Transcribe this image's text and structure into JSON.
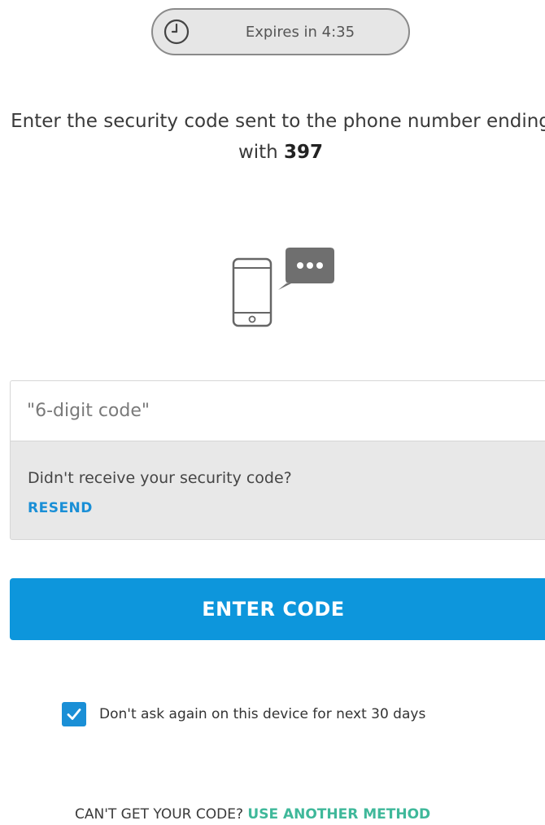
{
  "timer": {
    "text": "Expires in 4:35",
    "icon": "clock-icon"
  },
  "instruction": {
    "prefix": "Enter the security code sent to the phone number ending with",
    "last_digits": "397"
  },
  "illustration": {
    "icon": "phone-message-icon"
  },
  "code_input": {
    "placeholder": "\"6-digit code\"",
    "value": ""
  },
  "resend": {
    "prompt": "Didn't receive your security code?",
    "link_label": "RESEND"
  },
  "submit": {
    "label": "ENTER CODE"
  },
  "remember": {
    "checked": true,
    "label": "Don't ask again on this device for next 30 days"
  },
  "alternate": {
    "prompt": "CAN'T GET YOUR CODE?",
    "link_label": "USE ANOTHER METHOD"
  },
  "colors": {
    "primary_blue": "#0d96dc",
    "link_blue": "#1a8fd6",
    "link_green": "#3fb89a",
    "panel_gray": "#e8e8e8"
  }
}
